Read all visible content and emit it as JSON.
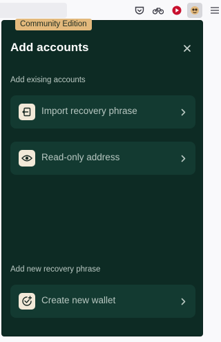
{
  "browser": {
    "toolbar_icons": [
      "pocket-icon",
      "bike-icon",
      "record-icon",
      "extension-icon",
      "menu-icon"
    ]
  },
  "panel": {
    "badge": "Community Edition",
    "title": "Add accounts",
    "close_icon": "close-icon",
    "existing_section": {
      "label": "Add exising accounts",
      "options": [
        {
          "label": "Import recovery phrase",
          "icon": "import-icon"
        },
        {
          "label": "Read-only address",
          "icon": "eye-icon"
        }
      ]
    },
    "new_section": {
      "label": "Add new recovery phrase",
      "options": [
        {
          "label": "Create new wallet",
          "icon": "add-wallet-icon"
        }
      ]
    }
  },
  "colors": {
    "panel_bg": "#0d2b24",
    "option_bg": "#133a31",
    "badge_bg": "#e3b97c",
    "icon_tile_bg": "#f2e9d8"
  }
}
